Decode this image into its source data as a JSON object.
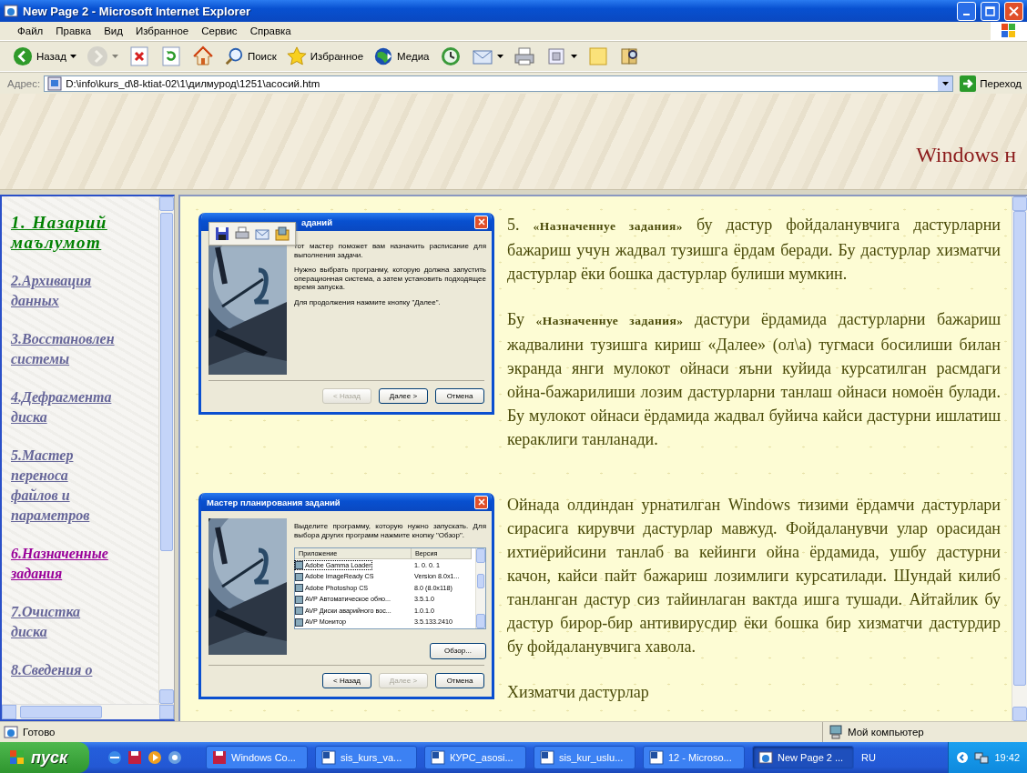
{
  "window": {
    "title": "New Page 2 - Microsoft Internet Explorer"
  },
  "menu": [
    "Файл",
    "Правка",
    "Вид",
    "Избранное",
    "Сервис",
    "Справка"
  ],
  "toolbar": [
    {
      "kind": "back",
      "label": "Назад",
      "disabled": false,
      "dropdown": true
    },
    {
      "kind": "forward",
      "disabled": true,
      "dropdown": true
    },
    {
      "kind": "stop",
      "disabled": false,
      "dropdown": false
    },
    {
      "kind": "refresh",
      "disabled": false,
      "dropdown": false
    },
    {
      "kind": "home",
      "disabled": false,
      "dropdown": false
    },
    {
      "kind": "search",
      "label": "Поиск",
      "disabled": false,
      "dropdown": false
    },
    {
      "kind": "favorites",
      "label": "Избранное",
      "disabled": false,
      "dropdown": false
    },
    {
      "kind": "media",
      "label": "Медиа",
      "disabled": false,
      "dropdown": false
    },
    {
      "kind": "history",
      "disabled": false,
      "dropdown": false
    },
    {
      "kind": "mail",
      "disabled": false,
      "dropdown": true
    },
    {
      "kind": "print",
      "disabled": false,
      "dropdown": false
    },
    {
      "kind": "edit",
      "disabled": false,
      "dropdown": true
    },
    {
      "kind": "notes",
      "disabled": false,
      "dropdown": false
    },
    {
      "kind": "research",
      "disabled": false,
      "dropdown": false
    }
  ],
  "address": {
    "label": "Адрес:",
    "value": "D:\\info\\kurs_d\\8-ktiat-02\\1\\дилмурод\\1251\\асосий.htm",
    "go": "Переход"
  },
  "banner": {
    "title": "Windows н"
  },
  "sidebar": {
    "items": [
      {
        "kind": "heading",
        "lines": [
          "1. Назарий",
          "маълумот"
        ],
        "color": "#008000"
      },
      {
        "kind": "link",
        "lines": [
          "2.Архивация",
          "данных"
        ],
        "color": "#666699"
      },
      {
        "kind": "link",
        "lines": [
          "3.Восстановлен",
          "системы"
        ],
        "color": "#666699"
      },
      {
        "kind": "link",
        "lines": [
          "4.Дефрагмента",
          "диска"
        ],
        "color": "#666699"
      },
      {
        "kind": "link",
        "lines": [
          "5.Мастер",
          "переноса",
          "файлов и",
          "параметров"
        ],
        "color": "#666699"
      },
      {
        "kind": "link",
        "lines": [
          "6.Назначенные",
          "задания"
        ],
        "color": "#990099"
      },
      {
        "kind": "link",
        "lines": [
          "7.Очистка",
          "диска"
        ],
        "color": "#666699"
      },
      {
        "kind": "link",
        "lines": [
          "8.Сведения о"
        ],
        "color": "#666699"
      }
    ]
  },
  "article": {
    "blocks": [
      {
        "kind": "figure",
        "image_toolbar": true,
        "dialog": {
          "title": "аданий",
          "texts": [
            "тот мастер поможет вам назначить расписание для выполнения задачи.",
            "Нужно выбрать програнму, которую должна запустить операционная система, а затем установить подходящее время запуска.",
            "Для продолжения нажмите кнопку \"Далее\"."
          ],
          "buttons": [
            {
              "label": "< Назад",
              "disabled": true
            },
            {
              "label": "Далее >",
              "disabled": false
            },
            {
              "label": "Отмена",
              "disabled": false
            }
          ]
        }
      },
      {
        "kind": "paragraph",
        "segments": [
          {
            "kind": "text",
            "text": "5. "
          },
          {
            "kind": "quote",
            "text": "«Назначеннуе задания»"
          },
          {
            "kind": "text",
            "text": " бу дастур фойдаланувчига дастурларни бажариш учун жадвал тузишга ёрдам беради. Бу дастурлар хизматчи дастурлар ёки бошка дастурлар булиши мумкин."
          }
        ]
      },
      {
        "kind": "paragraph",
        "segments": [
          {
            "kind": "text",
            "text": "Бу "
          },
          {
            "kind": "quote",
            "text": "«Назначеннуе задания»"
          },
          {
            "kind": "text",
            "text": " дастури ёрдамида дастурларни бажариш жадвалини тузишга кириш «Далее» (ол\\а) тугмаси босилиши билан экранда янги мулокот ойнаси яъни куйида курсатилган расмдаги ойна-бажарилиши лозим дастурларни танлаш ойнаси номоён булади. Бу мулокот ойнаси ёрдамида жадвал буйича кайси дастурни ишлатиш кераклиги танланади."
          }
        ]
      },
      {
        "kind": "figure",
        "image_toolbar": false,
        "dialog": {
          "title": "Мастер планирования заданий",
          "texts": [
            "Выделите программу, которую нужно запускать. Для выбора других программ нажмите кнопку \"Обзор\"."
          ],
          "list": {
            "columns": [
              "Приложение",
              "Версия"
            ],
            "rows": [
              {
                "name": "Adobe Gamma Loader",
                "version": "1. 0. 0. 1",
                "selected": true
              },
              {
                "name": "Adobe ImageReady CS",
                "version": "Version 8.0x1...",
                "selected": false
              },
              {
                "name": "Adobe Photoshop CS",
                "version": "8.0 (8.0x118)",
                "selected": false
              },
              {
                "name": "AVP Автоматическое обно...",
                "version": "3.5.1.0",
                "selected": false
              },
              {
                "name": "AVP Диски аварийного вос...",
                "version": "1.0.1.0",
                "selected": false
              },
              {
                "name": "AVP Монитор",
                "version": "3.5.133.2410",
                "selected": false
              }
            ]
          },
          "browse": "Обзор...",
          "buttons": [
            {
              "label": "< Назад",
              "disabled": false
            },
            {
              "label": "Далее >",
              "disabled": true
            },
            {
              "label": "Отмена",
              "disabled": false
            }
          ]
        }
      },
      {
        "kind": "paragraph",
        "segments": [
          {
            "kind": "text",
            "text": "Ойнада олдиндан урнатилган Windows тизими ёрдамчи дастурлари сирасига кирувчи дастурлар мавжуд. Фойдаланувчи улар орасидан ихтиёрийсини танлаб ва кейинги ойна ёрдамида, ушбу дастурни качон, кайси пайт бажариш лозимлиги курсатилади. Шундай килиб танланган дастур сиз тайинлаган вактда ишга тушади. Айтайлик бу дастур бирор-бир антивирусдир ёки бошка бир хизматчи дастурдир бу фойдаланувчига хавола."
          }
        ]
      },
      {
        "kind": "paragraph",
        "segments": [
          {
            "kind": "text",
            "text": "Хизматчи дастурлар"
          }
        ]
      }
    ]
  },
  "status_bar": {
    "text": "Готово",
    "zone": "Мой компьютер"
  },
  "taskbar": {
    "start": "пуск",
    "tasks": [
      {
        "label": "Windows Co...",
        "kind": "app",
        "selected": false
      },
      {
        "label": "sis_kurs_va...",
        "kind": "word",
        "selected": false
      },
      {
        "label": "КУРС_asosi...",
        "kind": "word",
        "selected": false
      },
      {
        "label": "sis_kur_uslu...",
        "kind": "word",
        "selected": false
      },
      {
        "label": "12 - Microso...",
        "kind": "word",
        "selected": false
      },
      {
        "label": "New Page 2 ...",
        "kind": "ie",
        "selected": true
      }
    ],
    "language": "RU",
    "time": "19:42"
  }
}
